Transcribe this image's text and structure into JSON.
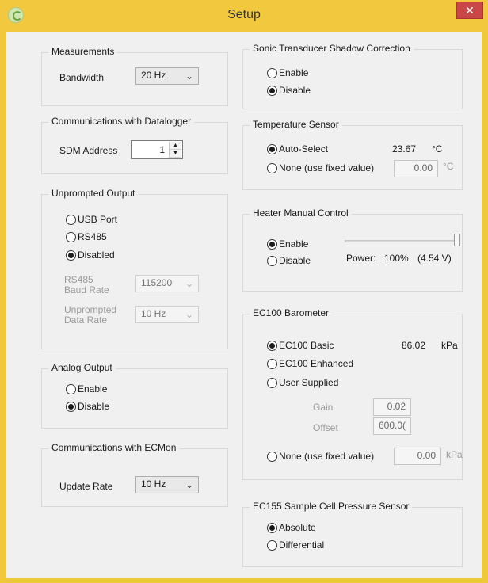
{
  "window": {
    "title": "Setup",
    "close_glyph": "✕"
  },
  "measurements": {
    "legend": "Measurements",
    "bandwidth_label": "Bandwidth",
    "bandwidth_value": "20 Hz"
  },
  "comms_datalogger": {
    "legend": "Communications with Datalogger",
    "sdm_label": "SDM Address",
    "sdm_value": "1"
  },
  "unprompted": {
    "legend": "Unprompted Output",
    "options": [
      "USB Port",
      "RS485",
      "Disabled"
    ],
    "selected": "Disabled",
    "baud_label_1": "RS485",
    "baud_label_2": "Baud Rate",
    "baud_value": "115200",
    "rate_label_1": "Unprompted",
    "rate_label_2": "Data Rate",
    "rate_value": "10 Hz"
  },
  "analog": {
    "legend": "Analog Output",
    "options": [
      "Enable",
      "Disable"
    ],
    "selected": "Disable"
  },
  "comms_ecmon": {
    "legend": "Communications with ECMon",
    "update_label": "Update Rate",
    "update_value": "10 Hz"
  },
  "sonic": {
    "legend": "Sonic Transducer Shadow Correction",
    "options": [
      "Enable",
      "Disable"
    ],
    "selected": "Disable"
  },
  "temperature": {
    "legend": "Temperature Sensor",
    "auto_label": "Auto-Select",
    "auto_value": "23.67",
    "auto_unit": "°C",
    "none_label": "None (use fixed value)",
    "fixed_value": "0.00",
    "fixed_unit": "°C",
    "selected": "Auto-Select"
  },
  "heater": {
    "legend": "Heater Manual Control",
    "options": [
      "Enable",
      "Disable"
    ],
    "selected": "Enable",
    "power_label": "Power:",
    "power_percent": "100%",
    "power_volts": "(4.54 V)",
    "slider_level": 1.0
  },
  "barometer": {
    "legend": "EC100 Barometer",
    "options": [
      "EC100 Basic",
      "EC100 Enhanced",
      "User Supplied"
    ],
    "selected": "EC100 Basic",
    "basic_value": "86.02",
    "basic_unit": "kPa",
    "gain_label": "Gain",
    "gain_value": "0.02",
    "offset_label": "Offset",
    "offset_value": "600.0(",
    "none_label": "None (use fixed value)",
    "fixed_value": "0.00",
    "fixed_unit": "kPa"
  },
  "ec155": {
    "legend": "EC155 Sample Cell Pressure Sensor",
    "options": [
      "Absolute",
      "Differential"
    ],
    "selected": "Absolute"
  },
  "colors": {
    "titlebar": "#f2c83f",
    "close": "#c94747",
    "client": "#f0f0f0"
  }
}
